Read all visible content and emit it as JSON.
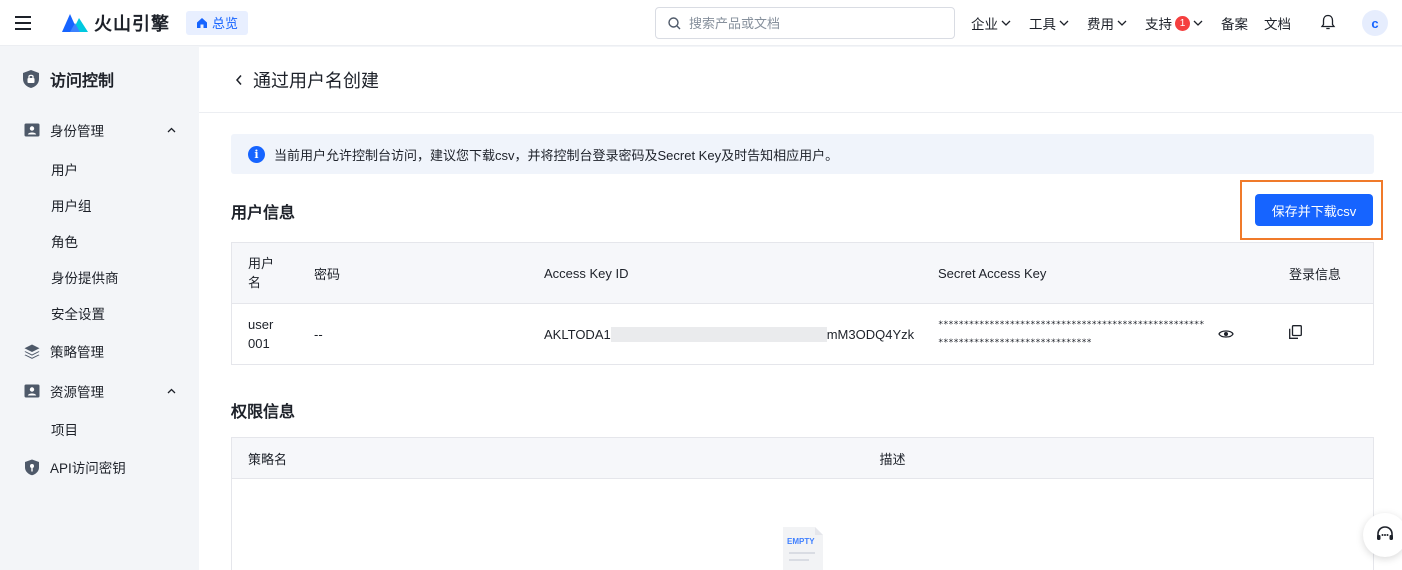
{
  "topbar": {
    "logo_text": "火山引擎",
    "overview_label": "总览",
    "search_placeholder": "搜索产品或文档",
    "nav": [
      {
        "label": "企业"
      },
      {
        "label": "工具"
      },
      {
        "label": "费用"
      },
      {
        "label": "支持",
        "badge": "1"
      }
    ],
    "filing_label": "备案",
    "docs_label": "文档",
    "avatar_initial": "c"
  },
  "sidebar": {
    "title": "访问控制",
    "groups": [
      {
        "label": "身份管理",
        "items": [
          "用户",
          "用户组",
          "角色",
          "身份提供商",
          "安全设置"
        ]
      },
      {
        "label": "策略管理"
      },
      {
        "label": "资源管理",
        "items": [
          "项目"
        ]
      },
      {
        "label": "API访问密钥"
      }
    ]
  },
  "page": {
    "title": "通过用户名创建",
    "alert": "当前用户允许控制台访问，建议您下载csv，并将控制台登录密码及Secret Key及时告知相应用户。",
    "user_section_title": "用户信息",
    "save_button": "保存并下载csv",
    "user_table": {
      "headers": [
        "用户名",
        "密码",
        "Access Key ID",
        "Secret Access Key",
        "登录信息"
      ],
      "row": {
        "username": "user001",
        "password": "--",
        "ak_prefix": "AKLTODA1",
        "ak_suffix": "mM3ODQ4Yzk",
        "secret_line1": "****************************************************",
        "secret_line2": "******************************"
      }
    },
    "perm_section_title": "权限信息",
    "perm_table": {
      "headers": [
        "策略名",
        "描述"
      ]
    },
    "empty_label": "EMPTY"
  }
}
